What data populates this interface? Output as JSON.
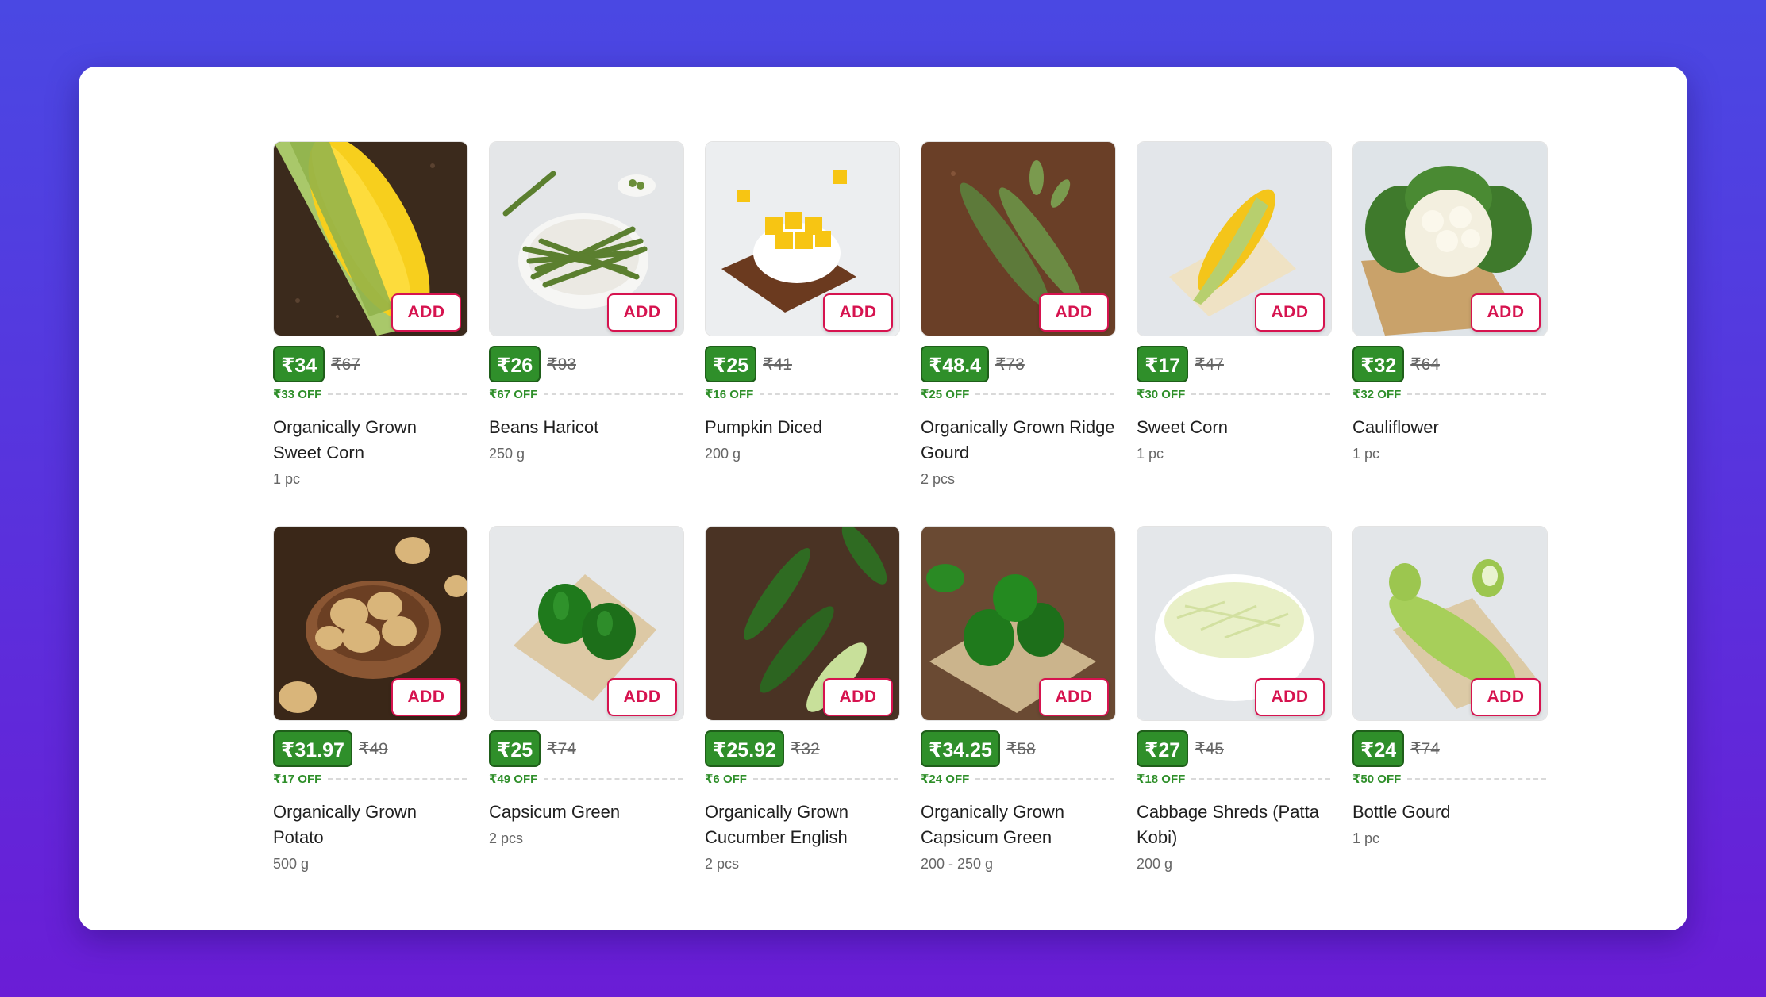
{
  "add_label": "ADD",
  "colors": {
    "accent_pink": "#d6134f",
    "discount_green": "#2f8f2a"
  },
  "products": [
    {
      "name": "Organically Grown Sweet Corn",
      "quantity": "1 pc",
      "price": "₹34",
      "mrp": "₹67",
      "off": "₹33 OFF",
      "image": "corn-cob-on-soil"
    },
    {
      "name": "Beans Haricot",
      "quantity": "250 g",
      "price": "₹26",
      "mrp": "₹93",
      "off": "₹67 OFF",
      "image": "green-beans-plate"
    },
    {
      "name": "Pumpkin Diced",
      "quantity": "200 g",
      "price": "₹25",
      "mrp": "₹41",
      "off": "₹16 OFF",
      "image": "diced-pumpkin-bowl"
    },
    {
      "name": "Organically Grown Ridge Gourd",
      "quantity": "2 pcs",
      "price": "₹48.4",
      "mrp": "₹73",
      "off": "₹25 OFF",
      "image": "ridge-gourd-on-soil"
    },
    {
      "name": "Sweet Corn",
      "quantity": "1 pc",
      "price": "₹17",
      "mrp": "₹47",
      "off": "₹30 OFF",
      "image": "sweet-corn-on-cloth"
    },
    {
      "name": "Cauliflower",
      "quantity": "1 pc",
      "price": "₹32",
      "mrp": "₹64",
      "off": "₹32 OFF",
      "image": "cauliflower-on-board"
    },
    {
      "name": "Organically Grown Potato",
      "quantity": "500 g",
      "price": "₹31.97",
      "mrp": "₹49",
      "off": "₹17 OFF",
      "image": "potatoes-in-bowl"
    },
    {
      "name": "Capsicum Green",
      "quantity": "2 pcs",
      "price": "₹25",
      "mrp": "₹74",
      "off": "₹49 OFF",
      "image": "capsicum-on-cloth"
    },
    {
      "name": "Organically Grown Cucumber English",
      "quantity": "2 pcs",
      "price": "₹25.92",
      "mrp": "₹32",
      "off": "₹6 OFF",
      "image": "cucumbers-on-soil"
    },
    {
      "name": "Organically Grown Capsicum Green",
      "quantity": "200 - 250 g",
      "price": "₹34.25",
      "mrp": "₹58",
      "off": "₹24 OFF",
      "image": "capsicum-on-soil"
    },
    {
      "name": "Cabbage Shreds (Patta Kobi)",
      "quantity": "200 g",
      "price": "₹27",
      "mrp": "₹45",
      "off": "₹18 OFF",
      "image": "cabbage-shreds-bowl"
    },
    {
      "name": "Bottle Gourd",
      "quantity": "1 pc",
      "price": "₹24",
      "mrp": "₹74",
      "off": "₹50 OFF",
      "image": "bottle-gourd-on-cloth"
    }
  ]
}
